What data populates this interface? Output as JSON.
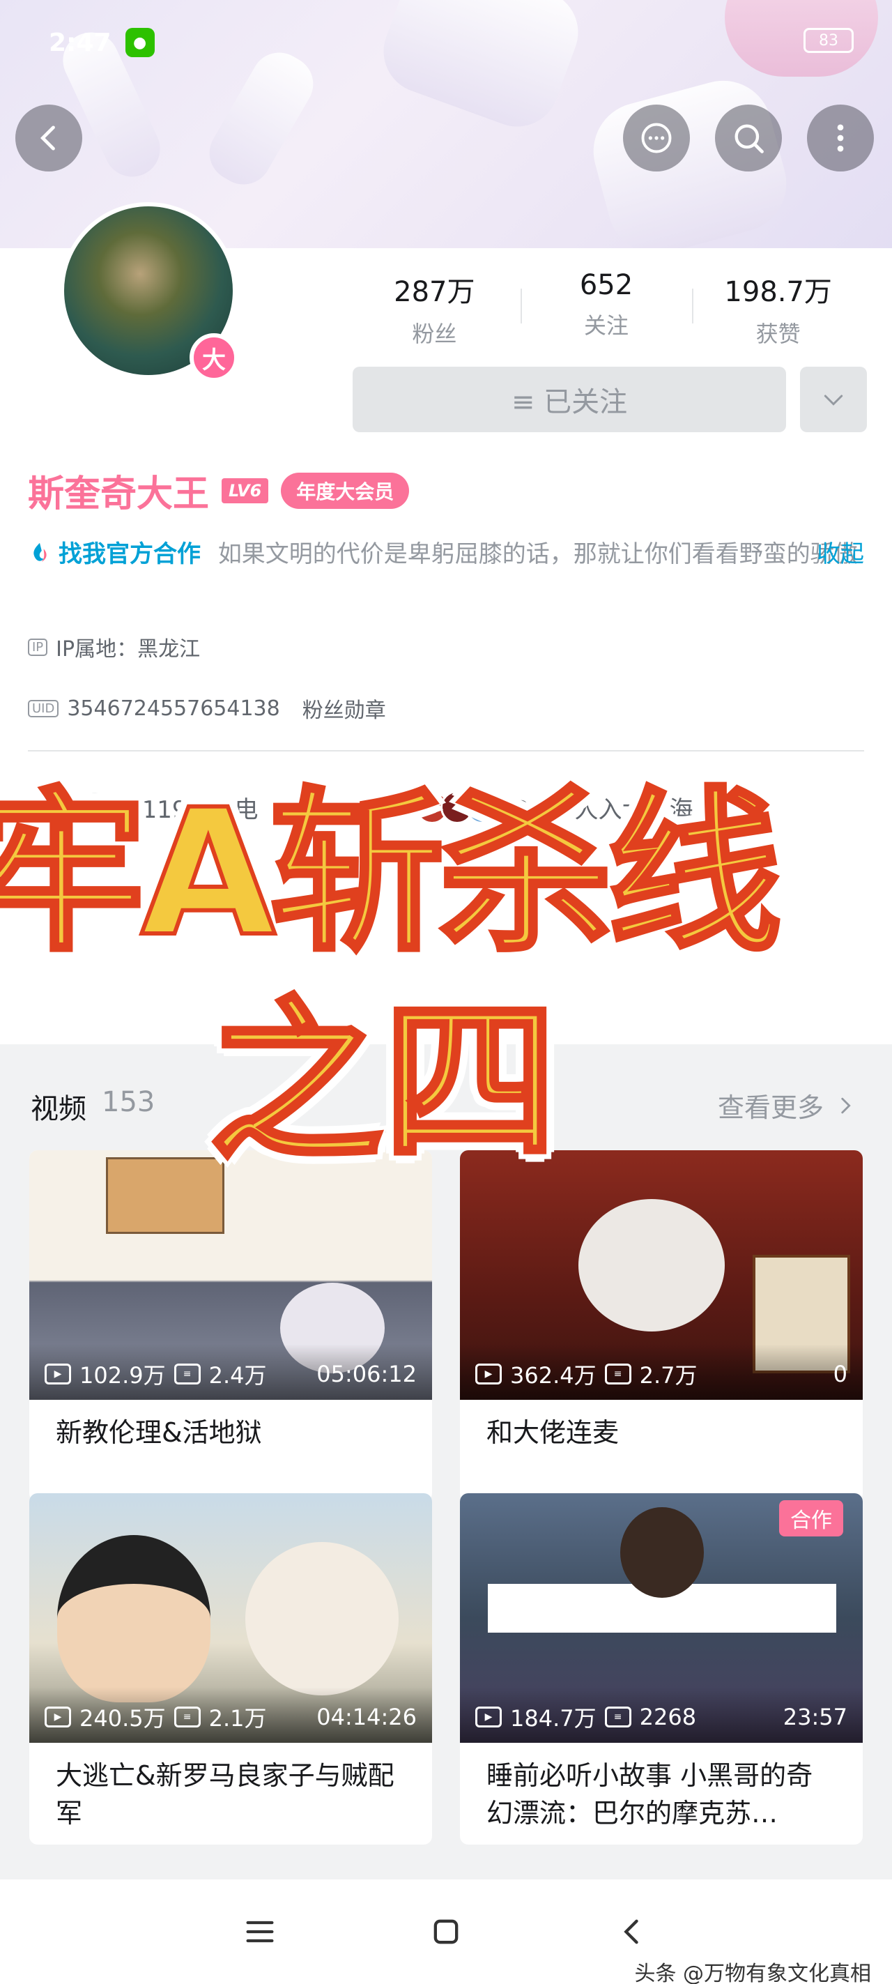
{
  "status_bar": {
    "time": "2:47",
    "battery": "83"
  },
  "stats": [
    {
      "value": "287万",
      "label": "粉丝"
    },
    {
      "value": "652",
      "label": "关注"
    },
    {
      "value": "198.7万",
      "label": "获赞"
    }
  ],
  "follow_button_label": "≡ 已关注",
  "profile": {
    "name": "斯奎奇大王",
    "level": "LV6",
    "vip_label": "年度大会员",
    "avatar_badge": "大",
    "cooperation_label": "找我官方合作",
    "signature": "如果文明的代价是卑躬屈膝的话，那就让你们看看野蛮的骄傲",
    "collapse_label": "收起",
    "ip_location": "IP属地：黑龙江",
    "uid": "3546724557654138",
    "fan_medal": "粉丝勋章"
  },
  "charge": {
    "left_text": "2119人充电",
    "right_text": "2908人入大航海"
  },
  "overlay_title": {
    "line1": "牢A斩杀线",
    "line2": "之四"
  },
  "videos_section": {
    "title": "视频",
    "count": "153",
    "more_label": "查看更多"
  },
  "videos": [
    {
      "views": "102.9万",
      "danmaku": "2.4万",
      "duration": "05:06:12",
      "title": "新教伦理&活地狱"
    },
    {
      "views": "362.4万",
      "danmaku": "2.7万",
      "duration": "0",
      "title": "和大佬连麦"
    },
    {
      "views": "240.5万",
      "danmaku": "2.1万",
      "duration": "04:14:26",
      "title": "大逃亡&新罗马良家子与贼配军"
    },
    {
      "views": "184.7万",
      "danmaku": "2268",
      "duration": "23:57",
      "title": "睡前必听小故事 小黑哥的奇幻漂流：巴尔的摩克苏…",
      "tag": "合作"
    }
  ],
  "watermark": "头条 @万物有象文化真相",
  "colors": {
    "accent": "#fb7299",
    "link": "#00a1d6",
    "overlay_fill": "#f4c93f",
    "overlay_stroke": "#e0401e"
  }
}
